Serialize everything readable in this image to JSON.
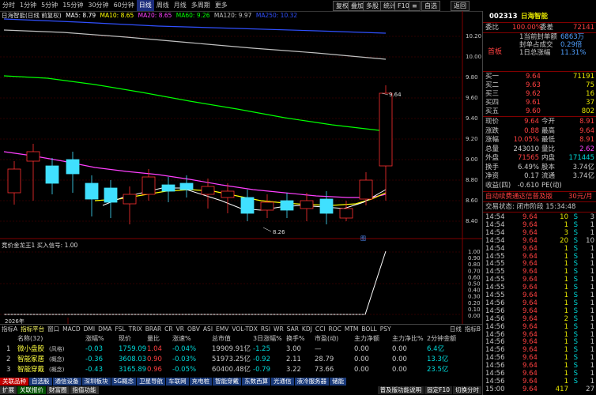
{
  "toolbar": {
    "periods": [
      "分时",
      "1分钟",
      "5分钟",
      "15分钟",
      "30分钟",
      "60分钟",
      "日线",
      "周线",
      "月线",
      "多周期",
      "更多"
    ],
    "active_period": "日线",
    "buttons": [
      "复权",
      "叠加",
      "多股",
      "统计",
      "F10",
      "≡",
      "自选",
      "返回"
    ]
  },
  "main_chart": {
    "title": "日海智能(日线 前复权)",
    "ma": [
      {
        "label": "MA5: 8.79",
        "color": "#ffffff"
      },
      {
        "label": "MA10: 8.65",
        "color": "#ffff00"
      },
      {
        "label": "MA20: 8.65",
        "color": "#ff40ff"
      },
      {
        "label": "MA60: 9.26",
        "color": "#00ff00"
      },
      {
        "label": "MA120: 9.97",
        "color": "#c0c0c0"
      },
      {
        "label": "MA250: 10.32",
        "color": "#3050ff"
      }
    ],
    "price_axis": [
      "10.20",
      "10.00",
      "9.80",
      "9.60",
      "9.40",
      "9.20",
      "9.00",
      "8.80",
      "8.60",
      "8.40"
    ],
    "annotations": {
      "high": "9.64",
      "low": "8.26"
    },
    "year_label": "2026年"
  },
  "sub_chart": {
    "title": "竞价金龙王1  买入信号: 1.00",
    "axis": [
      "1.00",
      "0.90",
      "0.80",
      "0.70",
      "0.60",
      "0.50",
      "0.40",
      "0.30",
      "0.20",
      "0.10",
      "0.00"
    ]
  },
  "indicator_tabs": {
    "left": [
      "指标A",
      "指标平台"
    ],
    "items": [
      "窗口",
      "MACD",
      "DMI",
      "DMA",
      "FSL",
      "TRIX",
      "BRAR",
      "CR",
      "VR",
      "OBV",
      "ASI",
      "EMV",
      "VOL-TDX",
      "RSI",
      "WR",
      "SAR",
      "KDJ",
      "CCI",
      "ROC",
      "MTM",
      "BOLL",
      "PSY"
    ],
    "right": [
      "指标B",
      "日线"
    ]
  },
  "quote": {
    "code": "002313",
    "name": "日海智能",
    "weibi_label": "委比",
    "weibi_pct": "100.00%",
    "weicha_label": "委差",
    "weicha": "72141",
    "limit_info": [
      {
        "label": "1当前封单额",
        "value": "6863万"
      },
      {
        "label": "封单占成交",
        "value": "0.29倍"
      },
      {
        "label": "1日总涨幅",
        "value": "11.31%"
      }
    ],
    "shoufan": "首板",
    "asks": [
      {
        "label": "卖五",
        "price": "",
        "vol": ""
      },
      {
        "label": "卖四",
        "price": "",
        "vol": ""
      },
      {
        "label": "卖三",
        "price": "",
        "vol": ""
      },
      {
        "label": "卖二",
        "price": "",
        "vol": ""
      },
      {
        "label": "卖一",
        "price": "",
        "vol": ""
      }
    ],
    "bids": [
      {
        "label": "买一",
        "price": "9.64",
        "vol": "71191"
      },
      {
        "label": "买二",
        "price": "9.63",
        "vol": "75"
      },
      {
        "label": "买三",
        "price": "9.62",
        "vol": "16"
      },
      {
        "label": "买四",
        "price": "9.61",
        "vol": "37"
      },
      {
        "label": "买五",
        "price": "9.60",
        "vol": "802"
      }
    ],
    "stats": [
      {
        "l1": "现价",
        "v1": "9.64",
        "l2": "今开",
        "v2": "8.91"
      },
      {
        "l1": "涨跌",
        "v1": "0.88",
        "l2": "最高",
        "v2": "9.64"
      },
      {
        "l1": "涨幅",
        "v1": "10.05%",
        "l2": "最低",
        "v2": "8.91"
      },
      {
        "l1": "总量",
        "v1": "243010",
        "l2": "量比",
        "v2": "2.62"
      },
      {
        "l1": "外盘",
        "v1": "71565",
        "l2": "内盘",
        "v2": "171445"
      },
      {
        "l1": "换手",
        "v1": "6.49%",
        "l2": "股本",
        "v2": "3.74亿"
      },
      {
        "l1": "净资",
        "v1": "0.17",
        "l2": "流通",
        "v2": "3.74亿"
      },
      {
        "l1": "收益(四)",
        "v1": "-0.610",
        "l2": "PE(动)",
        "v2": ""
      }
    ],
    "promo": "自动续费通达信普及版",
    "promo_price": "30元/月",
    "status": "交易状态: 闭市阶段 15:34:48",
    "ticks": [
      {
        "t": "14:54",
        "p": "9.64",
        "v": "10",
        "d": "S",
        "n": "3"
      },
      {
        "t": "14:54",
        "p": "9.64",
        "v": "1",
        "d": "S",
        "n": "1"
      },
      {
        "t": "14:54",
        "p": "9.64",
        "v": "3",
        "d": "S",
        "n": "1"
      },
      {
        "t": "14:54",
        "p": "9.64",
        "v": "20",
        "d": "S",
        "n": "10"
      },
      {
        "t": "14:54",
        "p": "9.64",
        "v": "1",
        "d": "S",
        "n": "1"
      },
      {
        "t": "14:55",
        "p": "9.64",
        "v": "1",
        "d": "S",
        "n": "1"
      },
      {
        "t": "14:55",
        "p": "9.64",
        "v": "1",
        "d": "S",
        "n": "1"
      },
      {
        "t": "14:55",
        "p": "9.64",
        "v": "1",
        "d": "S",
        "n": "1"
      },
      {
        "t": "14:55",
        "p": "9.64",
        "v": "1",
        "d": "S",
        "n": "1"
      },
      {
        "t": "14:55",
        "p": "9.64",
        "v": "1",
        "d": "S",
        "n": "1"
      },
      {
        "t": "14:55",
        "p": "9.64",
        "v": "1",
        "d": "S",
        "n": "1"
      },
      {
        "t": "14:56",
        "p": "9.64",
        "v": "1",
        "d": "S",
        "n": "1"
      },
      {
        "t": "14:56",
        "p": "9.64",
        "v": "1",
        "d": "S",
        "n": "1"
      },
      {
        "t": "14:56",
        "p": "9.64",
        "v": "2",
        "d": "S",
        "n": "1"
      },
      {
        "t": "14:56",
        "p": "9.64",
        "v": "1",
        "d": "S",
        "n": "1"
      },
      {
        "t": "14:56",
        "p": "9.64",
        "v": "1",
        "d": "S",
        "n": "1"
      },
      {
        "t": "14:56",
        "p": "9.64",
        "v": "1",
        "d": "S",
        "n": "1"
      },
      {
        "t": "14:56",
        "p": "9.64",
        "v": "1",
        "d": "S",
        "n": "1"
      },
      {
        "t": "14:56",
        "p": "9.64",
        "v": "1",
        "d": "S",
        "n": "1"
      },
      {
        "t": "14:56",
        "p": "9.64",
        "v": "1",
        "d": "S",
        "n": "1"
      },
      {
        "t": "14:56",
        "p": "9.64",
        "v": "1",
        "d": "S",
        "n": "1"
      },
      {
        "t": "14:56",
        "p": "9.64",
        "v": "1",
        "d": "S",
        "n": "1"
      },
      {
        "t": "15:00",
        "p": "9.64",
        "v": "417",
        "d": "",
        "n": "27"
      }
    ]
  },
  "sector_table": {
    "count_label": "名称(32)",
    "headers": [
      "涨幅%",
      "现价",
      "量比",
      "涨速%",
      "总市值",
      "3日涨幅%",
      "换手%",
      "市盈(动)",
      "主力净额",
      "主力净比%",
      "2分钟金额"
    ],
    "rows": [
      {
        "idx": "1",
        "name": "微小盘股",
        "tag": "(风格)",
        "chg": "-0.03",
        "price": "1759.09",
        "lb": "1.04",
        "spd": "-0.04%",
        "mv": "19909.91亿",
        "d3": "-1.25",
        "hs": "3.00",
        "pe": "—",
        "zl": "0.00",
        "zlb": "0.00",
        "amt": "6.4亿"
      },
      {
        "idx": "2",
        "name": "智能家居",
        "tag": "(概念)",
        "chg": "-0.36",
        "price": "3608.03",
        "lb": "0.90",
        "spd": "-0.03%",
        "mv": "51973.25亿",
        "d3": "-0.92",
        "hs": "2.11",
        "pe": "28.79",
        "zl": "0.00",
        "zlb": "0.00",
        "amt": "13.3亿"
      },
      {
        "idx": "3",
        "name": "智能穿戴",
        "tag": "(概念)",
        "chg": "-0.43",
        "price": "3165.89",
        "lb": "0.96",
        "spd": "-0.05%",
        "mv": "60400.48亿",
        "d3": "-0.79",
        "hs": "3.22",
        "pe": "73.66",
        "zl": "0.00",
        "zlb": "0.00",
        "amt": "23.5亿"
      }
    ]
  },
  "bottom_tabs": [
    "关联品种",
    "自选股",
    "通信设备",
    "深圳板块",
    "5G概念",
    "卫星导航",
    "车联网",
    "充电桩",
    "智能穿戴",
    "东数西算",
    "光通信",
    "液冷服务器",
    "储能"
  ],
  "bottom_bar2": [
    "扩展",
    "关联报价",
    "财富圈",
    "指值功能"
  ],
  "bottom_right": [
    "普及版功能说明",
    "固定F10",
    "切换分时"
  ]
}
